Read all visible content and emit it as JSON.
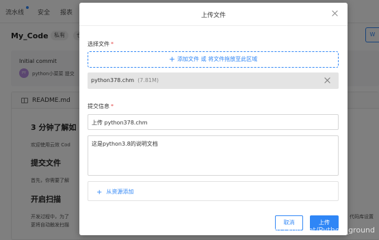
{
  "background": {
    "nav": {
      "pipeline": "流水线",
      "security": "安全",
      "report": "报表"
    },
    "repo_title": "My_Code",
    "chip_private": "私有",
    "chip_partial": "仓",
    "right_button": "W",
    "commit": {
      "title": "Initial commit",
      "avatar": "PY",
      "author": "python小菜菜  提交"
    },
    "readme_label": "README.md",
    "section1": {
      "title": "3 分钟了解如",
      "text": "欢迎使用云效 Cod"
    },
    "section2": {
      "title": "提交文件",
      "text": "首先，你需要了解"
    },
    "section3": {
      "title": "开启扫描",
      "text1": "开发过程中，为了",
      "text2": "更将自动触发扫描"
    },
    "right_text": "代码库设置"
  },
  "modal": {
    "title": "上传文件",
    "choose_file_label": "选择文件",
    "required_mark": "*",
    "dropzone_text": "添加文件 或 将文件拖放至此区域",
    "file": {
      "name": "python378.chm",
      "size": "(7.81M)"
    },
    "commit_label": "提交信息",
    "commit_title_value": "上传 python378.chm",
    "commit_desc_value": "这是python3.8的说明文档",
    "add_resource": "从资源添加",
    "cancel_label": "取消",
    "upload_label": "上传"
  },
  "watermark": "https://blog.csdn.net/Python_ground",
  "colors": {
    "accent": "#2f86f6",
    "required": "#e34a4a"
  }
}
